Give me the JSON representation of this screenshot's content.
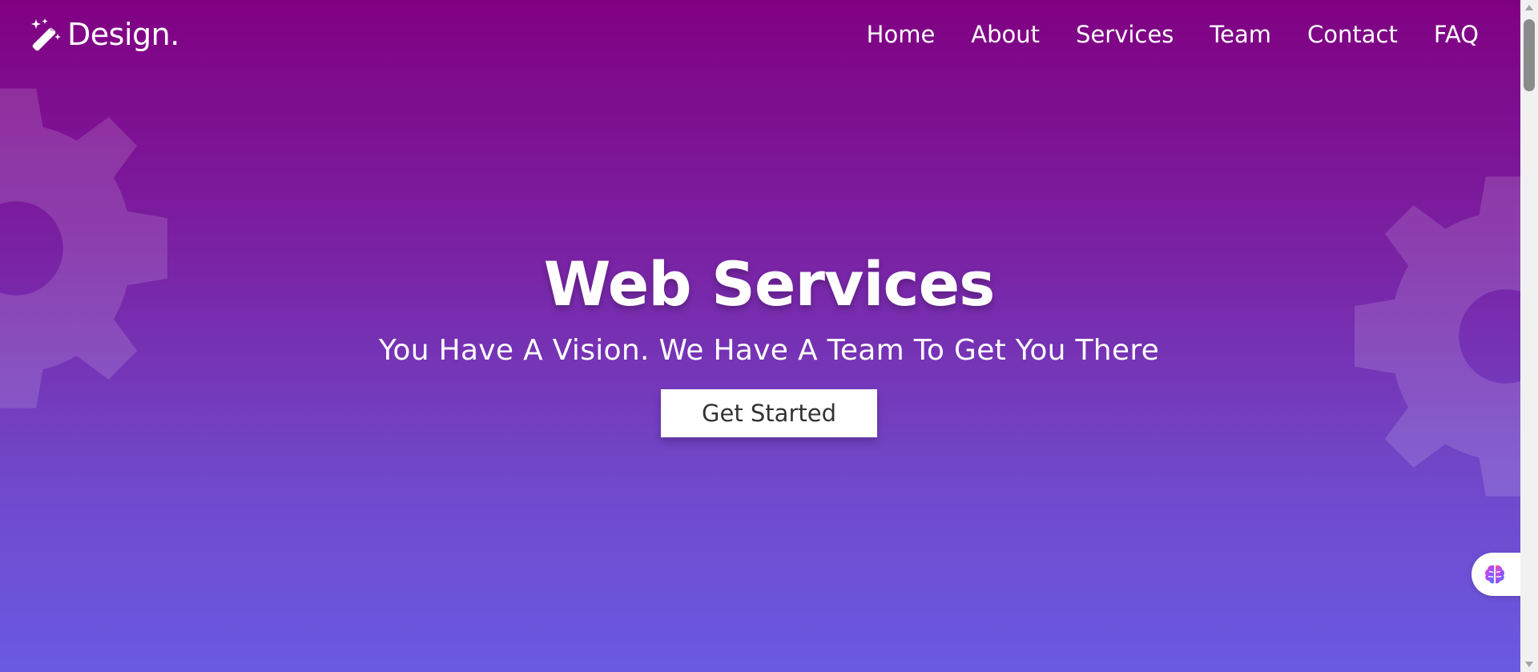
{
  "brand": {
    "logo_text": "Design.",
    "logo_icon": "magic-wand-icon"
  },
  "nav": {
    "items": [
      {
        "label": "Home"
      },
      {
        "label": "About"
      },
      {
        "label": "Services"
      },
      {
        "label": "Team"
      },
      {
        "label": "Contact"
      },
      {
        "label": "FAQ"
      }
    ]
  },
  "hero": {
    "title": "Web Services",
    "subtitle": "You Have A Vision. We Have A Team To Get You There",
    "cta_label": "Get Started",
    "gradient_top": "#810082",
    "gradient_bottom": "#6a5ae2"
  },
  "widget": {
    "icon": "brain-icon"
  },
  "colors": {
    "text": "#ffffff",
    "button_text": "#333333",
    "button_bg": "#ffffff"
  }
}
